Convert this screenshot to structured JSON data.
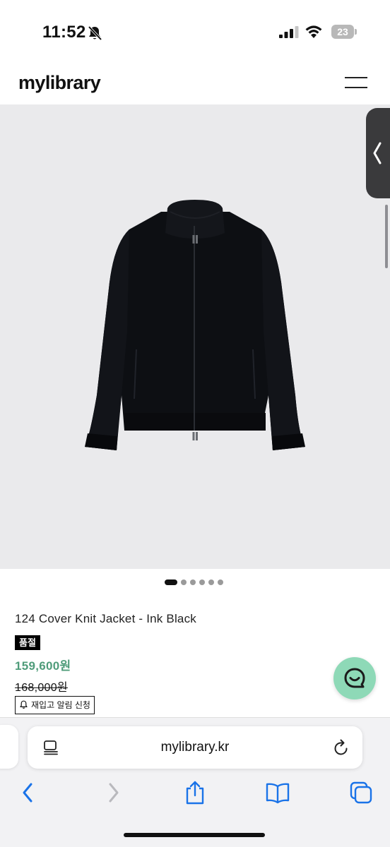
{
  "status_bar": {
    "time": "11:52",
    "battery": "23",
    "icons": [
      "bell-slash-icon",
      "signal-icon",
      "wifi-icon",
      "battery-icon"
    ]
  },
  "site": {
    "logo": "mylibrary",
    "menu_icon": "hamburger-menu-icon"
  },
  "gallery": {
    "image": "black zip-up knit jacket",
    "total_images": 6,
    "active_index": 0
  },
  "product": {
    "title": "124 Cover Knit Jacket - Ink Black",
    "badge": "품절",
    "sale_price": "159,600원",
    "original_price": "168,000원",
    "restock_label": "재입고 알림 신청"
  },
  "browser": {
    "url": "mylibrary.kr",
    "toolbar_icons": [
      "back-icon",
      "forward-icon",
      "share-icon",
      "bookmarks-icon",
      "tabs-icon"
    ]
  },
  "colors": {
    "accent_price": "#4f9c7a",
    "chat_button": "#8ed9b7",
    "image_bg": "#eaeaec"
  }
}
